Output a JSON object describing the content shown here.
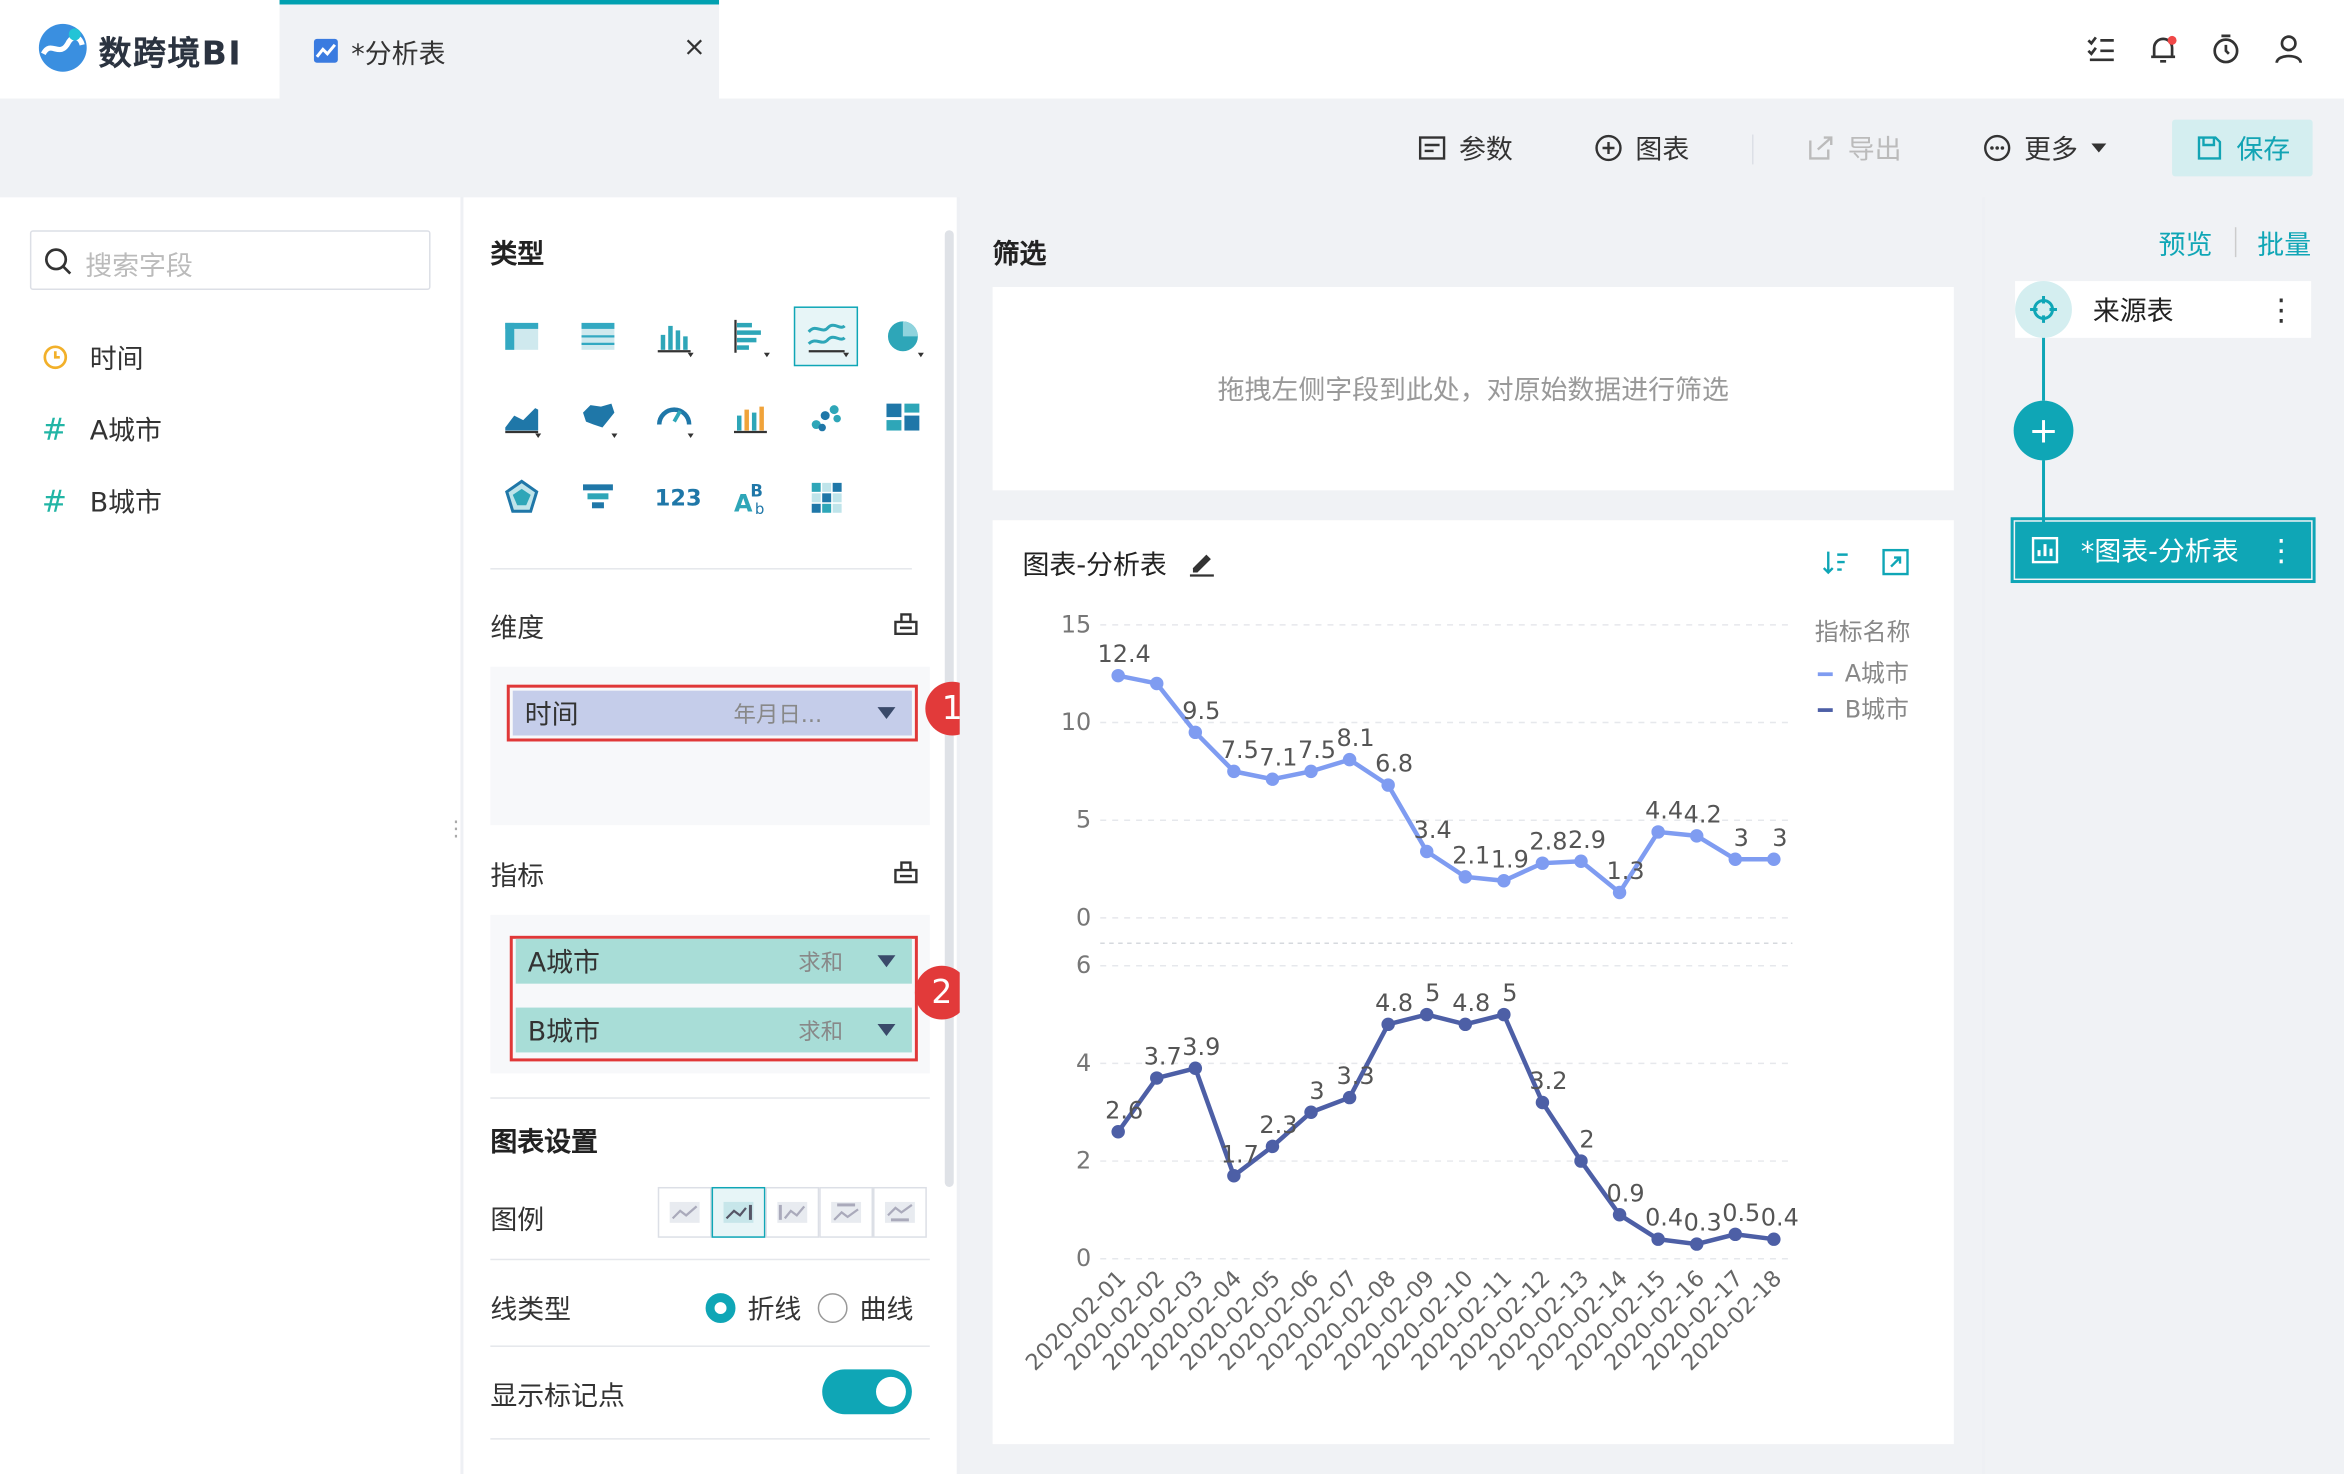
{
  "app": {
    "name": "数跨境BI"
  },
  "tab": {
    "title": "*分析表",
    "close": "×"
  },
  "toolbar": {
    "params": "参数",
    "chart": "图表",
    "export": "导出",
    "more": "更多",
    "save": "保存"
  },
  "fields": {
    "search_placeholder": "搜索字段",
    "items": [
      {
        "name": "时间",
        "kind": "date"
      },
      {
        "name": "A城市",
        "kind": "number"
      },
      {
        "name": "B城市",
        "kind": "number"
      }
    ]
  },
  "config": {
    "type_title": "类型",
    "dimension_title": "维度",
    "dimension_pill": {
      "name": "时间",
      "agg": "年月日..."
    },
    "metric_title": "指标",
    "metric_pills": [
      {
        "name": "A城市",
        "agg": "求和"
      },
      {
        "name": "B城市",
        "agg": "求和"
      }
    ],
    "settings_title": "图表设置",
    "legend_label": "图例",
    "line_type_label": "线类型",
    "line_type_options": [
      "折线",
      "曲线"
    ],
    "line_type_selected": "折线",
    "show_markers_label": "显示标记点",
    "show_markers": true,
    "annotations": [
      "1",
      "2"
    ]
  },
  "filter": {
    "title": "筛选",
    "placeholder": "拖拽左侧字段到此处，对原始数据进行筛选"
  },
  "chart_card": {
    "title": "图表-分析表"
  },
  "chart_data": {
    "type": "line",
    "layout": "two vertically stacked panels sharing the x axis",
    "categories": [
      "2020-02-01",
      "2020-02-02",
      "2020-02-03",
      "2020-02-04",
      "2020-02-05",
      "2020-02-06",
      "2020-02-07",
      "2020-02-08",
      "2020-02-09",
      "2020-02-10",
      "2020-02-11",
      "2020-02-12",
      "2020-02-13",
      "2020-02-14",
      "2020-02-15",
      "2020-02-16",
      "2020-02-17",
      "2020-02-18"
    ],
    "series": [
      {
        "name": "A城市",
        "color": "#7f9cf1",
        "ylim": [
          0,
          15
        ],
        "yticks": [
          "15",
          "10",
          "5",
          "0"
        ],
        "values": [
          12.4,
          12.0,
          9.5,
          7.5,
          7.1,
          7.5,
          8.1,
          6.8,
          3.4,
          2.1,
          1.9,
          2.8,
          2.9,
          1.3,
          4.4,
          4.2,
          3,
          3
        ],
        "labels": [
          "12.4",
          "",
          "9.5",
          "7.5",
          "7.1",
          "7.5",
          "8.1",
          "6.8",
          "3.4",
          "2.1",
          "1.9",
          "2.8",
          "2.9",
          "1.3",
          "4.4",
          "4.2",
          "3",
          "3"
        ]
      },
      {
        "name": "B城市",
        "color": "#4d5fa6",
        "ylim": [
          0,
          6
        ],
        "yticks": [
          "6",
          "4",
          "2",
          "0"
        ],
        "values": [
          2.6,
          3.7,
          3.9,
          1.7,
          2.3,
          3,
          3.3,
          4.8,
          5,
          4.8,
          5,
          3.2,
          2,
          0.9,
          0.4,
          0.3,
          0.5,
          0.4
        ],
        "labels": [
          "2.6",
          "3.7",
          "3.9",
          "1.7",
          "2.3",
          "3",
          "3.3",
          "4.8",
          "5",
          "4.8",
          "5",
          "3.2",
          "2",
          "0.9",
          "0.4",
          "0.3",
          "0.5",
          "0.4"
        ]
      }
    ],
    "legend_title": "指标名称",
    "legend_position": "top-right",
    "grid": true
  },
  "right_panel": {
    "preview": "预览",
    "batch": "批量",
    "source_node": "来源表",
    "chart_node": "*图表-分析表"
  },
  "colors": {
    "accent": "#0fa6b6",
    "dimension_pill": "#c5cdea",
    "metric_pill": "#a8ddd7",
    "annotation": "#e23a3a"
  }
}
